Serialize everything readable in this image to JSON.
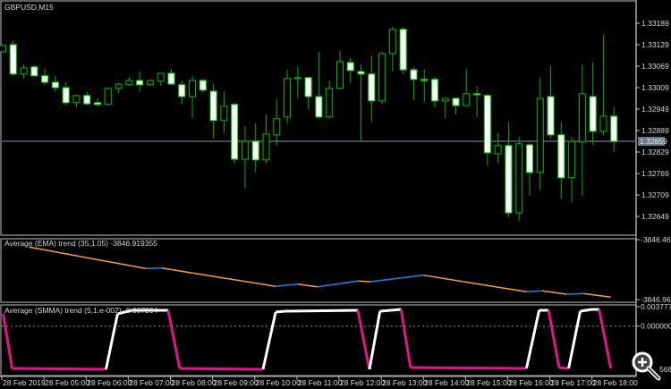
{
  "window": {
    "symbol_label": "GBPUSD,M15"
  },
  "colors": {
    "background": "#000000",
    "grid_frame": "#808080",
    "bull_outline": "#00c000",
    "bear_fill": "#ffffff",
    "wick": "#00b000",
    "last_price_line": "#5a6270",
    "last_price_bg": "#6b7789",
    "ema_down": "#f0a040",
    "ema_up": "#1e88e5",
    "smma_up": "#ffffff",
    "smma_down": "#e0168c"
  },
  "chart_data": [
    {
      "type": "candlestick",
      "title": "GBPUSD,M15",
      "last_price": "1.32859",
      "ylim": [
        1.32649,
        1.33189
      ],
      "y_ticks": [
        "1.33189",
        "1.33129",
        "1.33069",
        "1.33009",
        "1.32949",
        "1.32889",
        "1.32829",
        "1.32769",
        "1.32709",
        "1.32649"
      ],
      "x_ticks": [
        "28 Feb 2019",
        "28 Feb 05:00",
        "28 Feb 06:00",
        "28 Feb 07:00",
        "28 Feb 08:00",
        "28 Feb 09:00",
        "28 Feb 10:00",
        "28 Feb 11:00",
        "28 Feb 12:00",
        "28 Feb 13:00",
        "28 Feb 14:00",
        "28 Feb 15:00",
        "28 Feb 16:00",
        "28 Feb 17:00",
        "28 Feb 18:00"
      ],
      "bars_per_tick": 4,
      "ohlc": [
        [
          1.33109,
          1.33129,
          1.33107,
          1.33127
        ],
        [
          1.33129,
          1.33139,
          1.33042,
          1.33047
        ],
        [
          1.33047,
          1.33074,
          1.33034,
          1.33064
        ],
        [
          1.33067,
          1.33072,
          1.33042,
          1.33042
        ],
        [
          1.33042,
          1.33062,
          1.33017,
          1.33024
        ],
        [
          1.33024,
          1.33042,
          1.32997,
          1.33009
        ],
        [
          1.33009,
          1.33024,
          1.32959,
          1.32967
        ],
        [
          1.32967,
          1.32989,
          1.32954,
          1.32987
        ],
        [
          1.32987,
          1.32997,
          1.32959,
          1.32964
        ],
        [
          1.32967,
          1.32979,
          1.32957,
          1.32962
        ],
        [
          1.32962,
          1.33009,
          1.32959,
          1.33007
        ],
        [
          1.33007,
          1.33022,
          1.32994,
          1.33019
        ],
        [
          1.33017,
          1.33039,
          1.33014,
          1.33029
        ],
        [
          1.33029,
          1.33054,
          1.32997,
          1.33017
        ],
        [
          1.33017,
          1.33032,
          1.33014,
          1.33029
        ],
        [
          1.33027,
          1.33049,
          1.33014,
          1.33049
        ],
        [
          1.33049,
          1.33062,
          1.33017,
          1.33019
        ],
        [
          1.33017,
          1.33029,
          1.32962,
          1.32984
        ],
        [
          1.32984,
          1.33042,
          1.32924,
          1.33029
        ],
        [
          1.33029,
          1.33034,
          1.32994,
          1.33002
        ],
        [
          1.32999,
          1.33019,
          1.32867,
          1.32917
        ],
        [
          1.32917,
          1.32999,
          1.32882,
          1.32957
        ],
        [
          1.32962,
          1.32967,
          1.32797,
          1.32809
        ],
        [
          1.32809,
          1.32902,
          1.32729,
          1.32859
        ],
        [
          1.32859,
          1.32909,
          1.32772,
          1.32807
        ],
        [
          1.32807,
          1.32934,
          1.32797,
          1.32879
        ],
        [
          1.32877,
          1.32977,
          1.32847,
          1.32922
        ],
        [
          1.32927,
          1.33059,
          1.32909,
          1.33034
        ],
        [
          1.33034,
          1.33069,
          1.32979,
          1.33037
        ],
        [
          1.33037,
          1.33039,
          1.32949,
          1.32984
        ],
        [
          1.32984,
          1.33109,
          1.32922,
          1.32927
        ],
        [
          1.32927,
          1.33029,
          1.32922,
          1.33007
        ],
        [
          1.33007,
          1.33112,
          1.33004,
          1.33082
        ],
        [
          1.33079,
          1.33092,
          1.33022,
          1.33057
        ],
        [
          1.33054,
          1.33074,
          1.32857,
          1.33047
        ],
        [
          1.33047,
          1.33099,
          1.32912,
          1.32972
        ],
        [
          1.32972,
          1.33109,
          1.32964,
          1.33104
        ],
        [
          1.33104,
          1.33179,
          1.33054,
          1.33172
        ],
        [
          1.33172,
          1.33179,
          1.33047,
          1.33059
        ],
        [
          1.33059,
          1.33067,
          1.32974,
          1.33032
        ],
        [
          1.33032,
          1.33059,
          1.32967,
          1.33029
        ],
        [
          1.33032,
          1.33039,
          1.32954,
          1.32972
        ],
        [
          1.32972,
          1.32979,
          1.32924,
          1.32979
        ],
        [
          1.32979,
          1.32979,
          1.32934,
          1.32959
        ],
        [
          1.32959,
          1.33062,
          1.32957,
          1.32992
        ],
        [
          1.32992,
          1.33014,
          1.32927,
          1.32989
        ],
        [
          1.32987,
          1.32992,
          1.32792,
          1.32827
        ],
        [
          1.32824,
          1.32882,
          1.32799,
          1.32847
        ],
        [
          1.32847,
          1.32912,
          1.32647,
          1.32659
        ],
        [
          1.32659,
          1.32872,
          1.32637,
          1.32852
        ],
        [
          1.32849,
          1.32852,
          1.32707,
          1.32772
        ],
        [
          1.32772,
          1.33037,
          1.32722,
          1.32979
        ],
        [
          1.32984,
          1.33069,
          1.32867,
          1.32877
        ],
        [
          1.32877,
          1.32912,
          1.32699,
          1.32757
        ],
        [
          1.32757,
          1.32872,
          1.32689,
          1.32859
        ],
        [
          1.32857,
          1.33072,
          1.32707,
          1.32992
        ],
        [
          1.32984,
          1.33079,
          1.32849,
          1.32887
        ],
        [
          1.32887,
          1.33156,
          1.32877,
          1.32929
        ],
        [
          1.32929,
          1.32954,
          1.32829,
          1.32859
        ]
      ]
    },
    {
      "type": "line",
      "title": "Average (EMA) trend (35,1.05) -3846.919355",
      "ylim": [
        -3846.96229,
        -3846.4679
      ],
      "y_ticks": [
        "-3846.46790",
        "-3846.96229"
      ],
      "points": [
        [
          3.5,
          -3846.5291
        ],
        [
          14.6,
          -3846.7062
        ],
        [
          16.1,
          -3846.7018
        ],
        [
          26.9,
          -3846.8538
        ],
        [
          29,
          -3846.8346
        ],
        [
          30.9,
          -3846.8568
        ],
        [
          34.7,
          -3846.8095
        ],
        [
          35.9,
          -3846.8147
        ],
        [
          40.9,
          -3846.7608
        ],
        [
          50.7,
          -3846.8981
        ],
        [
          52.2,
          -3846.8907
        ],
        [
          54.5,
          -3846.918
        ],
        [
          56.1,
          -3846.9128
        ],
        [
          58.7,
          -3846.9424
        ]
      ]
    },
    {
      "type": "line",
      "title": "Average (SMMA) trend (5,1.e-002) -0.007294",
      "ylim": [
        -0.008568,
        0.003777
      ],
      "y_ticks": [
        "0.003777",
        "0.000000"
      ],
      "bottom_tick_partial": "568",
      "zero_line": true,
      "points": [
        [
          1.05,
          0.00238
        ],
        [
          1.9,
          -0.00823
        ],
        [
          10.8,
          -0.00841
        ],
        [
          11.9,
          0.00238
        ],
        [
          13.2,
          0.00308
        ],
        [
          16.7,
          0.00308
        ],
        [
          17.8,
          -0.00823
        ],
        [
          25.7,
          -0.00841
        ],
        [
          26.9,
          0.00273
        ],
        [
          27.8,
          0.0029
        ],
        [
          34.7,
          0.00308
        ],
        [
          35.8,
          -0.00841
        ],
        [
          36.8,
          0.0029
        ],
        [
          37.8,
          0.00308
        ],
        [
          38.8,
          0.00325
        ],
        [
          39.7,
          -0.00806
        ],
        [
          50.7,
          -0.00823
        ],
        [
          51.9,
          0.00308
        ],
        [
          52.8,
          0.00308
        ],
        [
          53.8,
          -0.00806
        ],
        [
          54.7,
          -0.00823
        ],
        [
          55.8,
          0.0029
        ],
        [
          56.9,
          0.00325
        ],
        [
          57.6,
          0.00325
        ],
        [
          58.7,
          -0.00823
        ]
      ]
    }
  ],
  "icons": {
    "zoom": "magnifier-plus-icon"
  }
}
